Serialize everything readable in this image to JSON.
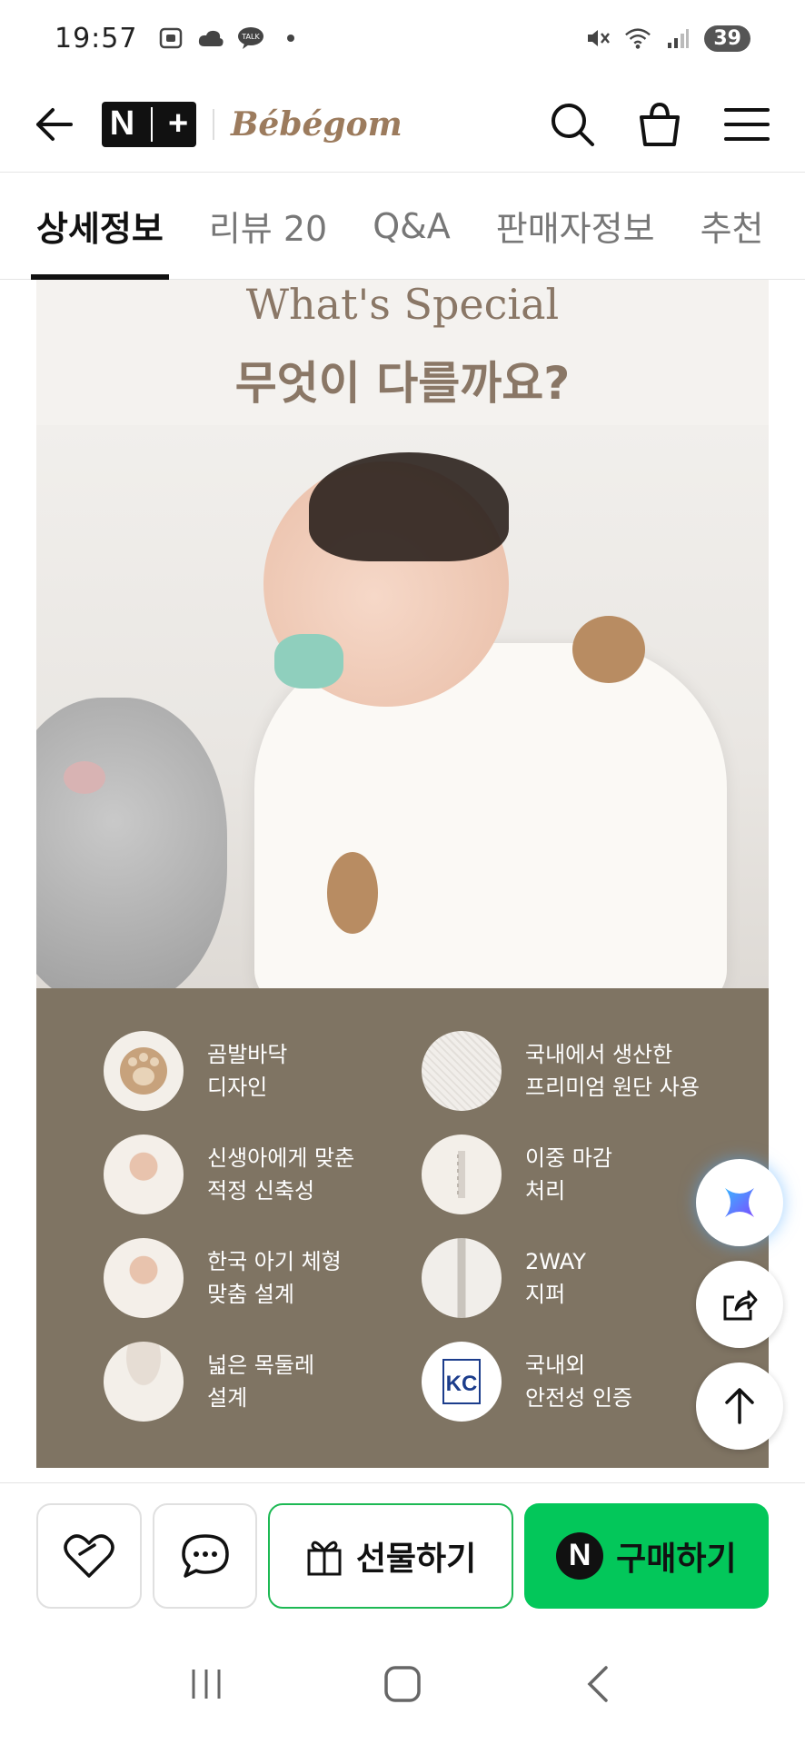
{
  "status_bar": {
    "time": "19:57",
    "battery": "39"
  },
  "header": {
    "logo_text_left": "N",
    "logo_text_right": "+",
    "brand": "Bébégom"
  },
  "tabs": [
    {
      "label": "상세정보",
      "active": true
    },
    {
      "label": "리뷰 20",
      "active": false
    },
    {
      "label": "Q&A",
      "active": false
    },
    {
      "label": "판매자정보",
      "active": false
    },
    {
      "label": "추천",
      "active": false
    }
  ],
  "content": {
    "title": "What's Special",
    "subtitle": "무엇이 다를까요?",
    "features": [
      {
        "line1": "곰발바닥",
        "line2": "디자인"
      },
      {
        "line1": "국내에서 생산한",
        "line2": "프리미엄 원단 사용"
      },
      {
        "line1": "신생아에게 맞춘",
        "line2": "적정 신축성"
      },
      {
        "line1": "이중 마감",
        "line2": "처리"
      },
      {
        "line1": "한국 아기 체형",
        "line2": "맞춤 설계"
      },
      {
        "line1": "2WAY",
        "line2": "지퍼"
      },
      {
        "line1": "넓은 목둘레",
        "line2": "설계"
      },
      {
        "line1": "국내외",
        "line2": "안전성 인증"
      }
    ],
    "kc_mark": "KC"
  },
  "bottom_bar": {
    "gift_label": "선물하기",
    "buy_label": "구매하기",
    "buy_badge": "N"
  },
  "colors": {
    "brand_brown": "#9c7b5d",
    "feature_panel": "#7f7463",
    "buy_green": "#03c75a"
  }
}
